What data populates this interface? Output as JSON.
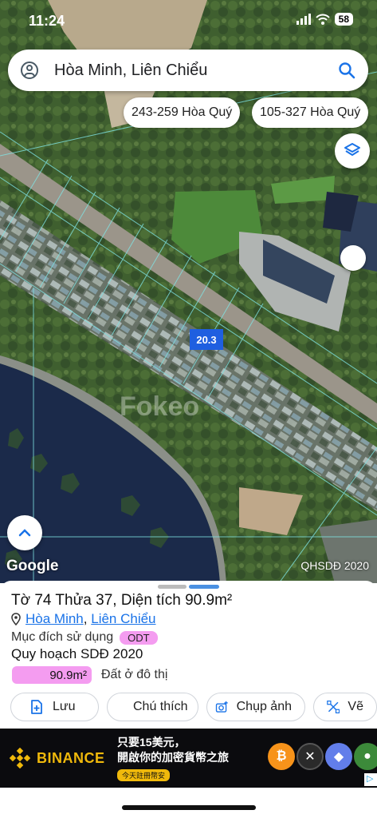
{
  "status_bar": {
    "time": "11:24",
    "battery": "58"
  },
  "search": {
    "query": "Hòa Minh, Liên Chiểu"
  },
  "suggestions": [
    "243-259 Hòa Quý",
    "105-327 Hòa Quý"
  ],
  "map": {
    "parcel_label": "20.3",
    "provider": "Google",
    "layer_source": "QHSDĐ 2020",
    "watermark": "Fokeo"
  },
  "sheet": {
    "title": "Tờ 74 Thửa 37, Diện tích 90.9m²",
    "location": {
      "ward": "Hòa Minh",
      "district": "Liên Chiểu",
      "separator": ","
    },
    "purpose_label": "Mục đích sử dụng",
    "purpose_code": "ODT",
    "plan_title": "Quy hoạch SDĐ 2020",
    "plan_area": "90.9m²",
    "plan_desc": "Đất ở đô thị",
    "actions": {
      "save": "Lưu",
      "note": "Chú thích",
      "photo": "Chụp ảnh",
      "measure": "Vẽ"
    }
  },
  "ad": {
    "brand": "BINANCE",
    "line1": "只要15美元，",
    "line2": "開啟你的加密貨幣之旅",
    "cta": "今天註冊幣安"
  },
  "colors": {
    "odt_pink": "#f49cf0",
    "accent_blue": "#1a73e8",
    "binance_yellow": "#f0b90b"
  }
}
